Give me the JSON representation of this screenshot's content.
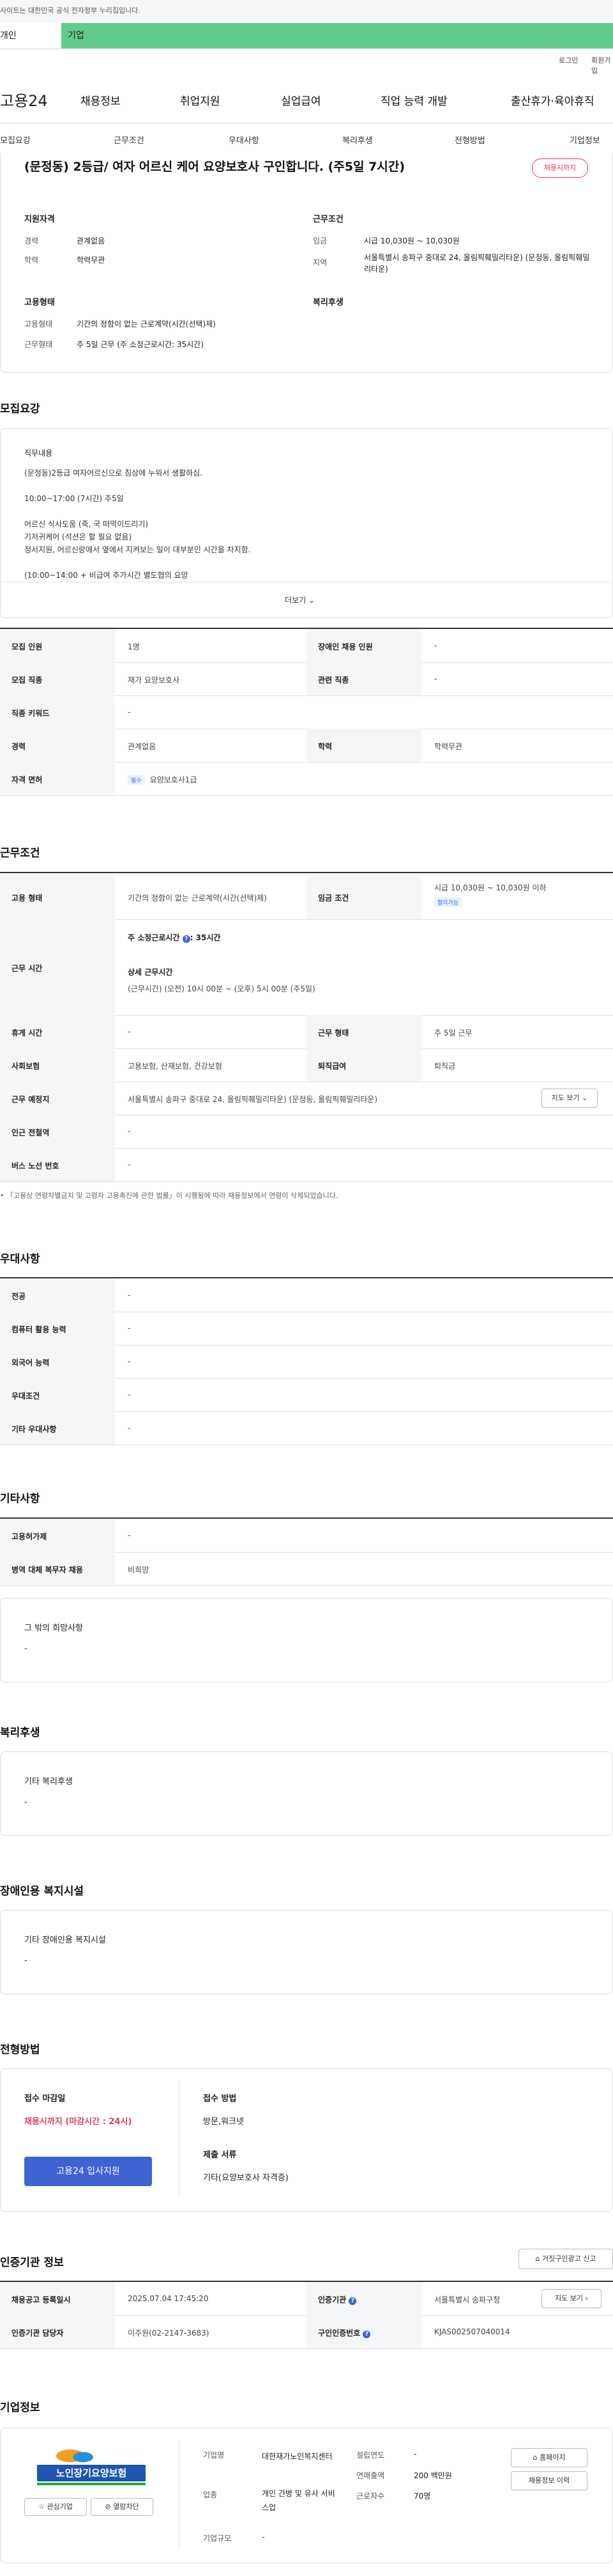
{
  "gov_bar": {
    "text": "사이트는 대한민국 공식 전자정부 누리집입니다."
  },
  "top_tabs": {
    "personal": "개인",
    "company": "기업"
  },
  "util": {
    "login": "로그인",
    "join": "회원가입"
  },
  "gnb": {
    "logo": "고용24",
    "items": [
      "채용정보",
      "취업지원",
      "실업급여",
      "직업 능력 개발",
      "출산휴가·육아휴직"
    ]
  },
  "lnb": {
    "items": [
      "모집요강",
      "근무조건",
      "우대사항",
      "복리후생",
      "전형방법",
      "기업정보"
    ]
  },
  "summary": {
    "title": "(문정동) 2등급/ 여자 어르신 케어 요양보호사 구인합니다. (주5일 7시간)",
    "status_badge": "채용시까지",
    "qual_title": "지원자격",
    "career_label": "경력",
    "career_value": "관계없음",
    "edu_label": "학력",
    "edu_value": "학력무관",
    "cond_title": "근무조건",
    "wage_label": "임금",
    "wage_value": "시급 10,030원 ~ 10,030원",
    "loc_label": "지역",
    "loc_value": "서울특별시 송파구 중대로 24, 올림픽훼밀리타운) (문정동, 올림픽훼밀리타운)",
    "emp_title": "고용형태",
    "emp_label": "고용형태",
    "emp_value": "기간의 정함이 없는 근로계약(시간(선택)제)",
    "work_label": "근무형태",
    "work_value": "주 5일 근무 (주 소정근로시간: 35시간)",
    "welfare_title": "복리후생"
  },
  "recruit": {
    "heading": "모집요강",
    "duty_title": "직무내용",
    "duty_lines": [
      "(문정동)2등급 여자어르신으로 침상에 누워서 생활하심.",
      "",
      "10:00~17:00 (7시간) 주5일",
      "",
      "어르신 식사도움 (죽, 국 떠먹이드리기)",
      "기저귀케어 (석션은 할 필요 없음)",
      "정서지원, 어르신랑에서 옆에서 지켜보는 일이 대부분인 시간을 차지함.",
      "",
      "(10:00~14:00 + 비급여 추가시간 별도협의 요망"
    ],
    "more": "더보기",
    "rows": [
      {
        "l1": "모집 인원",
        "v1": "1명",
        "l2": "장애인 채용 인원",
        "v2": "-"
      },
      {
        "l1": "모집 직종",
        "v1": "재가 요양보호사",
        "l2": "관련 직종",
        "v2": "-"
      },
      {
        "l1": "직종 키워드",
        "v1": "-",
        "l2": "",
        "v2": ""
      },
      {
        "l1": "경력",
        "v1": "관계없음",
        "l2": "학력",
        "v2": "학력무관"
      },
      {
        "l1": "자격 면허",
        "v1": "요양보호사1급",
        "l2": "",
        "v2": ""
      }
    ],
    "license_tag": "필수"
  },
  "conditions": {
    "heading": "근무조건",
    "emp_label": "고용 형태",
    "emp_value": "기간의 정함이 없는 근로계약(시간(선택)제)",
    "wage_label": "임금 조건",
    "wage_value": "시급 10,030원 ~ 10,030원 이하",
    "wage_tag": "협의가능",
    "hours_label": "근무 시간",
    "hours_title": "주 소정근로시간",
    "hours_value": ": 35시간",
    "detail_title": "상세 근무시간",
    "detail_value": "(근무시간) (오전) 10시 00분 ~ (오후) 5시 00분 (주5일)",
    "holiday_label": "휴게 시간",
    "holiday_value": "-",
    "worktype_label": "근무 형태",
    "worktype_value": "주 5일 근무",
    "insurance_label": "사회보험",
    "insurance_value": "고용보험, 산재보험, 건강보험",
    "retire_label": "퇴직급여",
    "retire_value": "퇴직금",
    "place_label": "근무 예정지",
    "place_value": "서울특별시 송파구 중대로 24, 올림픽훼밀리타운) (문정동, 올림픽훼밀리타운)",
    "map_btn": "지도 보기",
    "subway_label": "인근 전철역",
    "subway_value": "-",
    "bus_label": "버스 노선 번호",
    "bus_value": "-",
    "note": "「고용상 연령차별금지 및 고령자 고용촉진에 관한 법률」이 시행됨에 따라 채용정보에서 연령이 삭제되었습니다."
  },
  "preference": {
    "heading": "우대사항",
    "rows": [
      {
        "label": "전공",
        "value": "-"
      },
      {
        "label": "컴퓨터 활용 능력",
        "value": "-"
      },
      {
        "label": "외국어 능력",
        "value": "-"
      },
      {
        "label": "우대조건",
        "value": "-"
      },
      {
        "label": "기타 우대사항",
        "value": "-"
      }
    ]
  },
  "etc": {
    "heading": "기타사항",
    "rows": [
      {
        "label": "고용허가제",
        "value": "-"
      },
      {
        "label": "병역 대체 복무자 채용",
        "value": "비희망"
      }
    ],
    "hope_title": "그 밖의 희망사항",
    "hope_value": "-"
  },
  "welfare": {
    "heading": "복리후생",
    "box_title": "기타 복리후생",
    "box_value": "-"
  },
  "disabled": {
    "heading": "장애인용 복지시설",
    "box_title": "기타 장애인용 복지시설",
    "box_value": "-"
  },
  "apply": {
    "heading": "전형방법",
    "deadline_title": "접수 마감일",
    "deadline_value": "채용시까지 (마감시간 : 24시)",
    "apply_btn": "고용24 입사지원",
    "method_title": "접수 방법",
    "method_value": "방문,워크넷",
    "docs_title": "제출 서류",
    "docs_value": "기타(요양보호사 자격증)"
  },
  "cert": {
    "heading": "인증기관 정보",
    "report_btn": "거짓구인광고 신고",
    "reg_label": "채용공고 등록일시",
    "reg_value": "2025.07.04 17:45:20",
    "org_label": "인증기관",
    "org_value": "서울특별시 송파구청",
    "map_btn": "지도 보기",
    "manager_label": "인증기관 담당자",
    "manager_value": "이주원(02-2147-3683)",
    "id_label": "구인인증번호",
    "id_value": "KJAS002507040014"
  },
  "company": {
    "heading": "기업정보",
    "logo_text": "노인장기요양보험",
    "fav_btn": "관심기업",
    "block_btn": "열람차단",
    "type_label": "기업명",
    "type_value": "대한재가노인복지센터",
    "industry_label": "업종",
    "industry_value": "개인 간병 및 유사 서비스업",
    "size_label": "기업규모",
    "size_value": "-",
    "founded_label": "설립연도",
    "founded_value": "-",
    "sales_label": "연매출액",
    "sales_value": "200 백만원",
    "staff_label": "근로자수",
    "staff_value": "70명",
    "home_btn": "홈페이지",
    "jobs_btn": "채용정보 이력"
  }
}
